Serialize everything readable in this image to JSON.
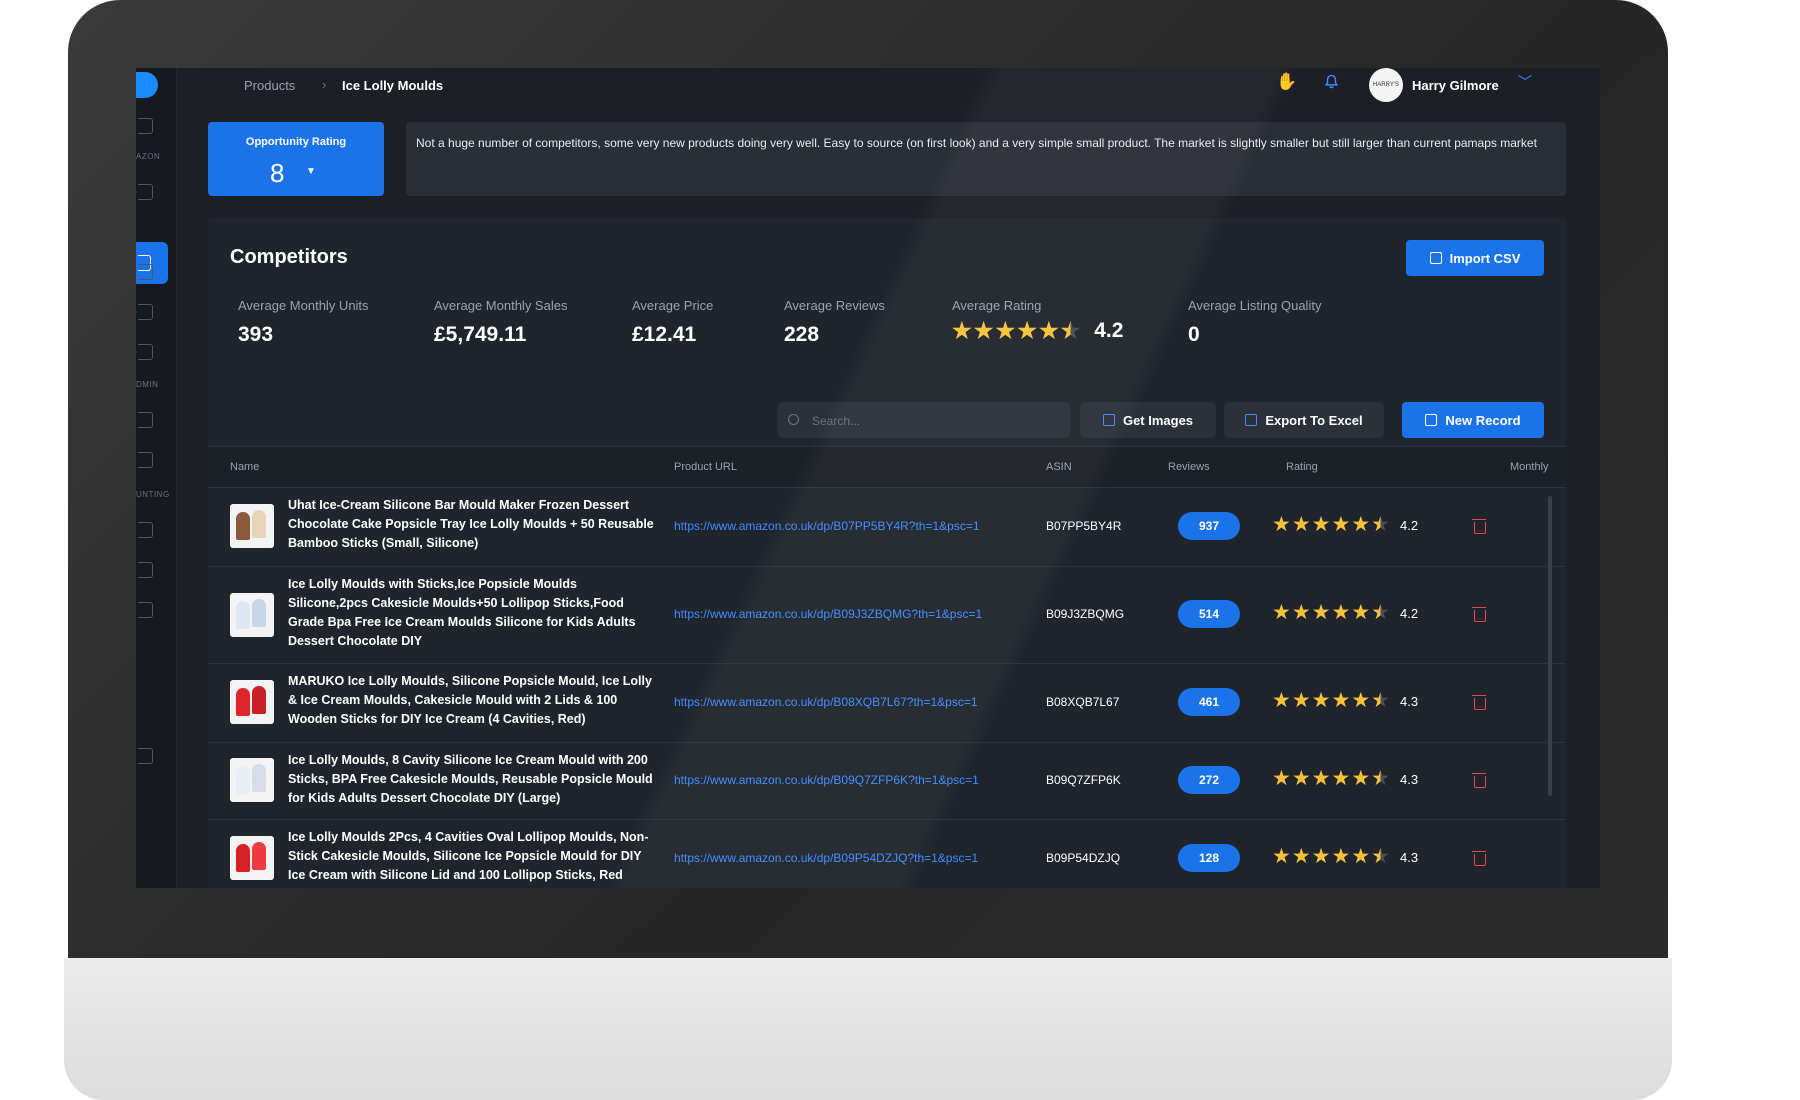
{
  "breadcrumb": {
    "root": "Products",
    "separator": "›",
    "current": "Ice Lolly Moulds"
  },
  "user": {
    "name": "Harry Gilmore",
    "avatar_text": "HARRY'S"
  },
  "sidebar_labels": [
    "AZON",
    "DMIN",
    "UNTING"
  ],
  "opportunity": {
    "title": "Opportunity Rating",
    "value": "8"
  },
  "note": "Not a huge number of competitors, some very new products doing very well. Easy to source (on first look) and a very simple small product. The market is slightly smaller but still larger than current pamaps market",
  "competitors": {
    "title": "Competitors",
    "import_label": "Import CSV",
    "stats": {
      "units_label": "Average Monthly Units",
      "units": "393",
      "sales_label": "Average Monthly Sales",
      "sales": "£5,749.11",
      "price_label": "Average Price",
      "price": "£12.41",
      "reviews_label": "Average Reviews",
      "reviews": "228",
      "rating_label": "Average Rating",
      "rating": "4.2",
      "quality_label": "Average Listing Quality",
      "quality": "0"
    },
    "search_placeholder": "Search...",
    "get_images_label": "Get Images",
    "export_label": "Export To Excel",
    "new_record_label": "New Record"
  },
  "table": {
    "headers": {
      "name": "Name",
      "url": "Product URL",
      "asin": "ASIN",
      "reviews": "Reviews",
      "rating": "Rating",
      "monthly": "Monthly"
    },
    "rows": [
      {
        "name": "Uhat Ice-Cream Silicone Bar Mould Maker Frozen Dessert Chocolate Cake Popsicle Tray Ice Lolly Moulds + 50 Reusable Bamboo Sticks (Small, Silicone)",
        "url": "https://www.amazon.co.uk/dp/B07PP5BY4R?th=1&psc=1",
        "asin": "B07PP5BY4R",
        "reviews": "937",
        "rating": "4.2"
      },
      {
        "name": "Ice Lolly Moulds with Sticks,Ice Popsicle Moulds Silicone,2pcs Cakesicle Moulds+50 Lollipop Sticks,Food Grade Bpa Free Ice Cream Moulds Silicone for Kids Adults Dessert Chocolate DIY",
        "url": "https://www.amazon.co.uk/dp/B09J3ZBQMG?th=1&psc=1",
        "asin": "B09J3ZBQMG",
        "reviews": "514",
        "rating": "4.2"
      },
      {
        "name": "MARUKO Ice Lolly Moulds, Silicone Popsicle Mould, Ice Lolly & Ice Cream Moulds, Cakesicle Mould with 2 Lids & 100 Wooden Sticks for DIY Ice Cream (4 Cavities, Red)",
        "url": "https://www.amazon.co.uk/dp/B08XQB7L67?th=1&psc=1",
        "asin": "B08XQB7L67",
        "reviews": "461",
        "rating": "4.3"
      },
      {
        "name": "Ice Lolly Moulds, 8 Cavity Silicone Ice Cream Mould with 200 Sticks, BPA Free Cakesicle Moulds, Reusable Popsicle Mould for Kids Adults Dessert Chocolate DIY (Large)",
        "url": "https://www.amazon.co.uk/dp/B09Q7ZFP6K?th=1&psc=1",
        "asin": "B09Q7ZFP6K",
        "reviews": "272",
        "rating": "4.3"
      },
      {
        "name": "Ice Lolly Moulds 2Pcs, 4 Cavities Oval Lollipop Moulds, Non-Stick Cakesicle Moulds, Silicone Ice Popsicle Mould for DIY Ice Cream with Silicone Lid and 100 Lollipop Sticks, Red",
        "url": "https://www.amazon.co.uk/dp/B09P54DZJQ?th=1&psc=1",
        "asin": "B09P54DZJQ",
        "reviews": "128",
        "rating": "4.3"
      }
    ]
  },
  "colors": {
    "accent": "#1a73e8",
    "link": "#3d8bff",
    "star": "#f7c23a",
    "danger": "#e5484d",
    "background": "#1c1f26"
  }
}
